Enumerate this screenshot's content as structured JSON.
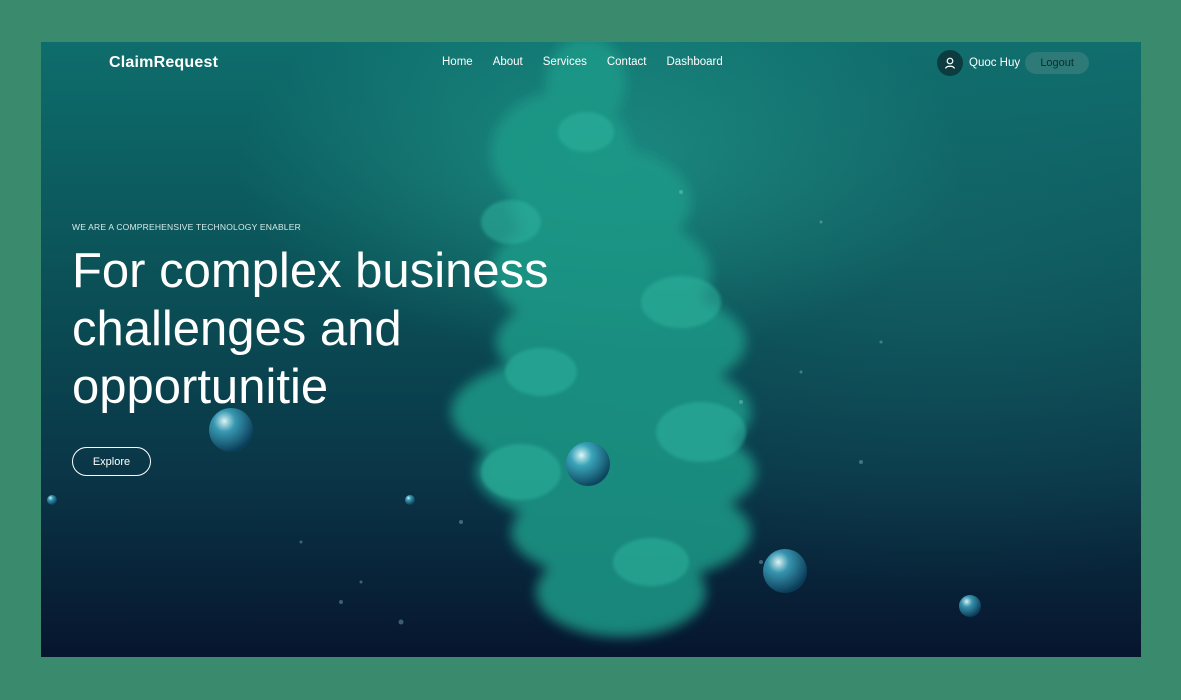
{
  "nav": {
    "brand": "ClaimRequest",
    "links": [
      "Home",
      "About",
      "Services",
      "Contact",
      "Dashboard"
    ],
    "user_name": "Quoc Huy",
    "logout_label": "Logout",
    "user_icon": "user-icon"
  },
  "hero": {
    "eyebrow": "WE ARE A COMPREHENSIVE TECHNOLOGY ENABLER",
    "headline_lines": [
      "For complex business",
      "challenges and",
      "opportunitie"
    ],
    "explore_label": "Explore"
  },
  "colors": {
    "page_border": "#3a8a6e",
    "smoke": "#1f9f8c",
    "bottom": "#07152e"
  }
}
